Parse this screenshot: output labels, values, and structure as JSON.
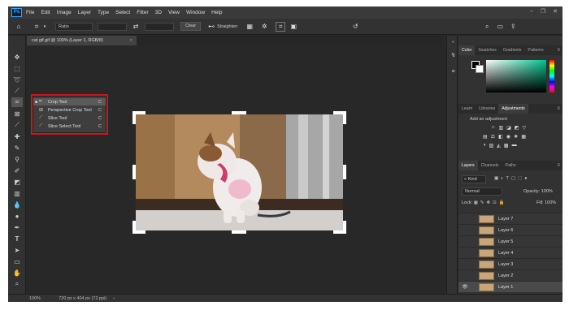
{
  "menubar": {
    "logo": "Ps",
    "items": [
      "File",
      "Edit",
      "Image",
      "Layer",
      "Type",
      "Select",
      "Filter",
      "3D",
      "View",
      "Window",
      "Help"
    ]
  },
  "options_bar": {
    "ratio_label": "Ratio",
    "clear_label": "Clear",
    "straighten_label": "Straighten"
  },
  "document": {
    "tab_title": "cat gif.gif @ 100% (Layer 1, RGB/8)",
    "close_glyph": "×"
  },
  "crop_flyout": {
    "items": [
      {
        "label": "Crop Tool",
        "shortcut": "C",
        "icon": "crop-icon"
      },
      {
        "label": "Perspective Crop Tool",
        "shortcut": "C",
        "icon": "perspective-crop-icon"
      },
      {
        "label": "Slice Tool",
        "shortcut": "C",
        "icon": "slice-icon"
      },
      {
        "label": "Slice Select Tool",
        "shortcut": "C",
        "icon": "slice-select-icon"
      }
    ]
  },
  "status_bar": {
    "zoom": "100%",
    "doc_info": "720 px x 404 px (72 ppi)"
  },
  "color_panel": {
    "tabs": [
      "Color",
      "Swatches",
      "Gradients",
      "Patterns"
    ],
    "active_tab": "Color"
  },
  "adjustments_panel": {
    "tabs": [
      "Learn",
      "Libraries",
      "Adjustments"
    ],
    "active_tab": "Adjustments",
    "heading": "Add an adjustment"
  },
  "layers_panel": {
    "tabs": [
      "Layers",
      "Channels",
      "Paths"
    ],
    "active_tab": "Layers",
    "filter_kind": "Kind",
    "blend_mode": "Normal",
    "opacity_label": "Opacity:",
    "opacity_value": "100%",
    "lock_label": "Lock:",
    "fill_label": "Fill:",
    "fill_value": "100%",
    "layers": [
      "Layer 7",
      "Layer 6",
      "Layer 5",
      "Layer 4",
      "Layer 3",
      "Layer 2",
      "Layer 1"
    ],
    "active_layer": "Layer 1"
  },
  "colors": {
    "highlight_box": "#d0161b",
    "ps_blue": "#31a8ff"
  }
}
